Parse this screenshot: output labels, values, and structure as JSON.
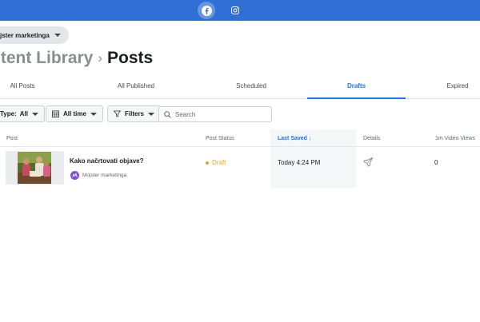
{
  "topbar": {
    "icons": [
      "facebook-icon",
      "instagram-icon"
    ],
    "accent": "#2f6fd6"
  },
  "account": {
    "name": "jster marketinga"
  },
  "breadcrumb": {
    "parent": "ntent Library",
    "separator": "›",
    "current": "Posts"
  },
  "tabs": [
    {
      "label": "All Posts",
      "active": false
    },
    {
      "label": "All Published",
      "active": false
    },
    {
      "label": "Scheduled",
      "active": false
    },
    {
      "label": "Drafts",
      "active": true
    },
    {
      "label": "Expired",
      "active": false
    }
  ],
  "filters": {
    "type_label": "Type:",
    "type_value": "All",
    "time_value": "All time",
    "filters_label": "Filters",
    "search_placeholder": "Search"
  },
  "table": {
    "columns": [
      "Post",
      "Post Status",
      "Last Saved ↓",
      "Details",
      "1m Video Views"
    ],
    "sorted_column": "Last Saved",
    "rows": [
      {
        "title": "Kako načrtovati objave?",
        "page": "Mojster marketinga",
        "status": "Draft",
        "last_saved": "Today 4:24 PM",
        "details_icon": "boost-rocket-icon",
        "video_views": "0"
      }
    ]
  },
  "colors": {
    "active": "#1877f2",
    "draft": "#e8a21b",
    "muted": "#8a8d91"
  }
}
